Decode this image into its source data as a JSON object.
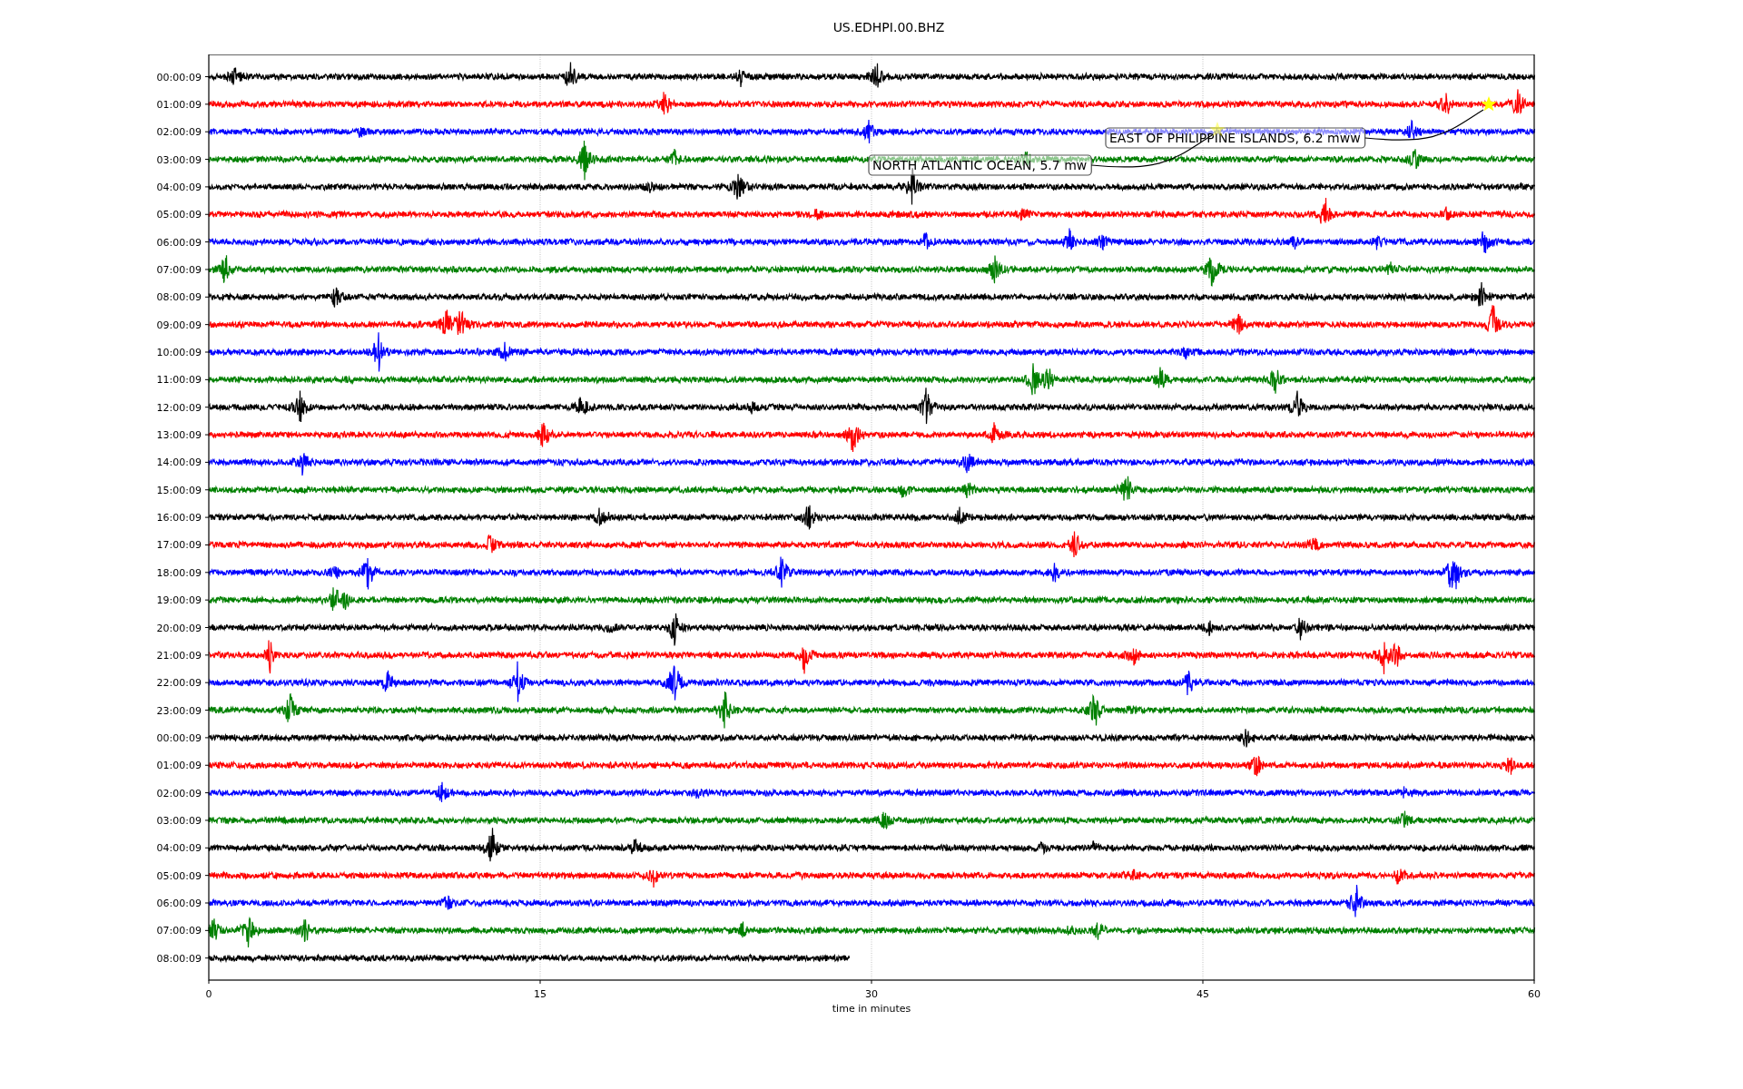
{
  "title": "US.EDHPI.00.BHZ",
  "traces": [
    {
      "label": "00:00:09",
      "color": "#000000",
      "level": 1
    },
    {
      "label": "01:00:09",
      "color": "#ff0000",
      "level": 1
    },
    {
      "label": "02:00:09",
      "color": "#0000ff",
      "level": 1
    },
    {
      "label": "03:00:09",
      "color": "#008000",
      "level": 1
    },
    {
      "label": "04:00:09",
      "color": "#000000",
      "level": 1
    },
    {
      "label": "05:00:09",
      "color": "#ff0000",
      "level": 1
    },
    {
      "label": "06:00:09",
      "color": "#0000ff",
      "level": 1
    },
    {
      "label": "07:00:09",
      "color": "#008000",
      "level": 1
    },
    {
      "label": "08:00:09",
      "color": "#000000",
      "level": 1
    },
    {
      "label": "09:00:09",
      "color": "#ff0000",
      "level": 1
    },
    {
      "label": "10:00:09",
      "color": "#0000ff",
      "level": 1
    },
    {
      "label": "11:00:09",
      "color": "#008000",
      "level": 1
    },
    {
      "label": "12:00:09",
      "color": "#000000",
      "level": 1
    },
    {
      "label": "13:00:09",
      "color": "#ff0000",
      "level": 1
    },
    {
      "label": "14:00:09",
      "color": "#0000ff",
      "level": 1
    },
    {
      "label": "15:00:09",
      "color": "#008000",
      "level": 1
    },
    {
      "label": "16:00:09",
      "color": "#000000",
      "level": 1
    },
    {
      "label": "17:00:09",
      "color": "#ff0000",
      "level": 1
    },
    {
      "label": "18:00:09",
      "color": "#0000ff",
      "level": 1
    },
    {
      "label": "19:00:09",
      "color": "#008000",
      "level": 1
    },
    {
      "label": "20:00:09",
      "color": "#000000",
      "level": 1
    },
    {
      "label": "21:00:09",
      "color": "#ff0000",
      "level": 1
    },
    {
      "label": "22:00:09",
      "color": "#0000ff",
      "level": 1
    },
    {
      "label": "23:00:09",
      "color": "#008000",
      "level": 1
    },
    {
      "label": "00:00:09",
      "color": "#000000",
      "level": 1
    },
    {
      "label": "01:00:09",
      "color": "#ff0000",
      "level": 1
    },
    {
      "label": "02:00:09",
      "color": "#0000ff",
      "level": 1
    },
    {
      "label": "03:00:09",
      "color": "#008000",
      "level": 1
    },
    {
      "label": "04:00:09",
      "color": "#000000",
      "level": 1
    },
    {
      "label": "05:00:09",
      "color": "#ff0000",
      "level": 1
    },
    {
      "label": "06:00:09",
      "color": "#0000ff",
      "level": 1
    },
    {
      "label": "07:00:09",
      "color": "#008000",
      "level": 1
    },
    {
      "label": "08:00:09",
      "color": "#000000",
      "level": 0.483
    }
  ],
  "xticks": [
    "0",
    "15",
    "30",
    "45",
    "60"
  ],
  "xlabel": "time in minutes",
  "annotations": [
    {
      "text": "EAST OF PHILIPPINE ISLANDS, 6.2 mww"
    },
    {
      "text": "NORTH ATLANTIC OCEAN, 5.7 mw"
    }
  ]
}
